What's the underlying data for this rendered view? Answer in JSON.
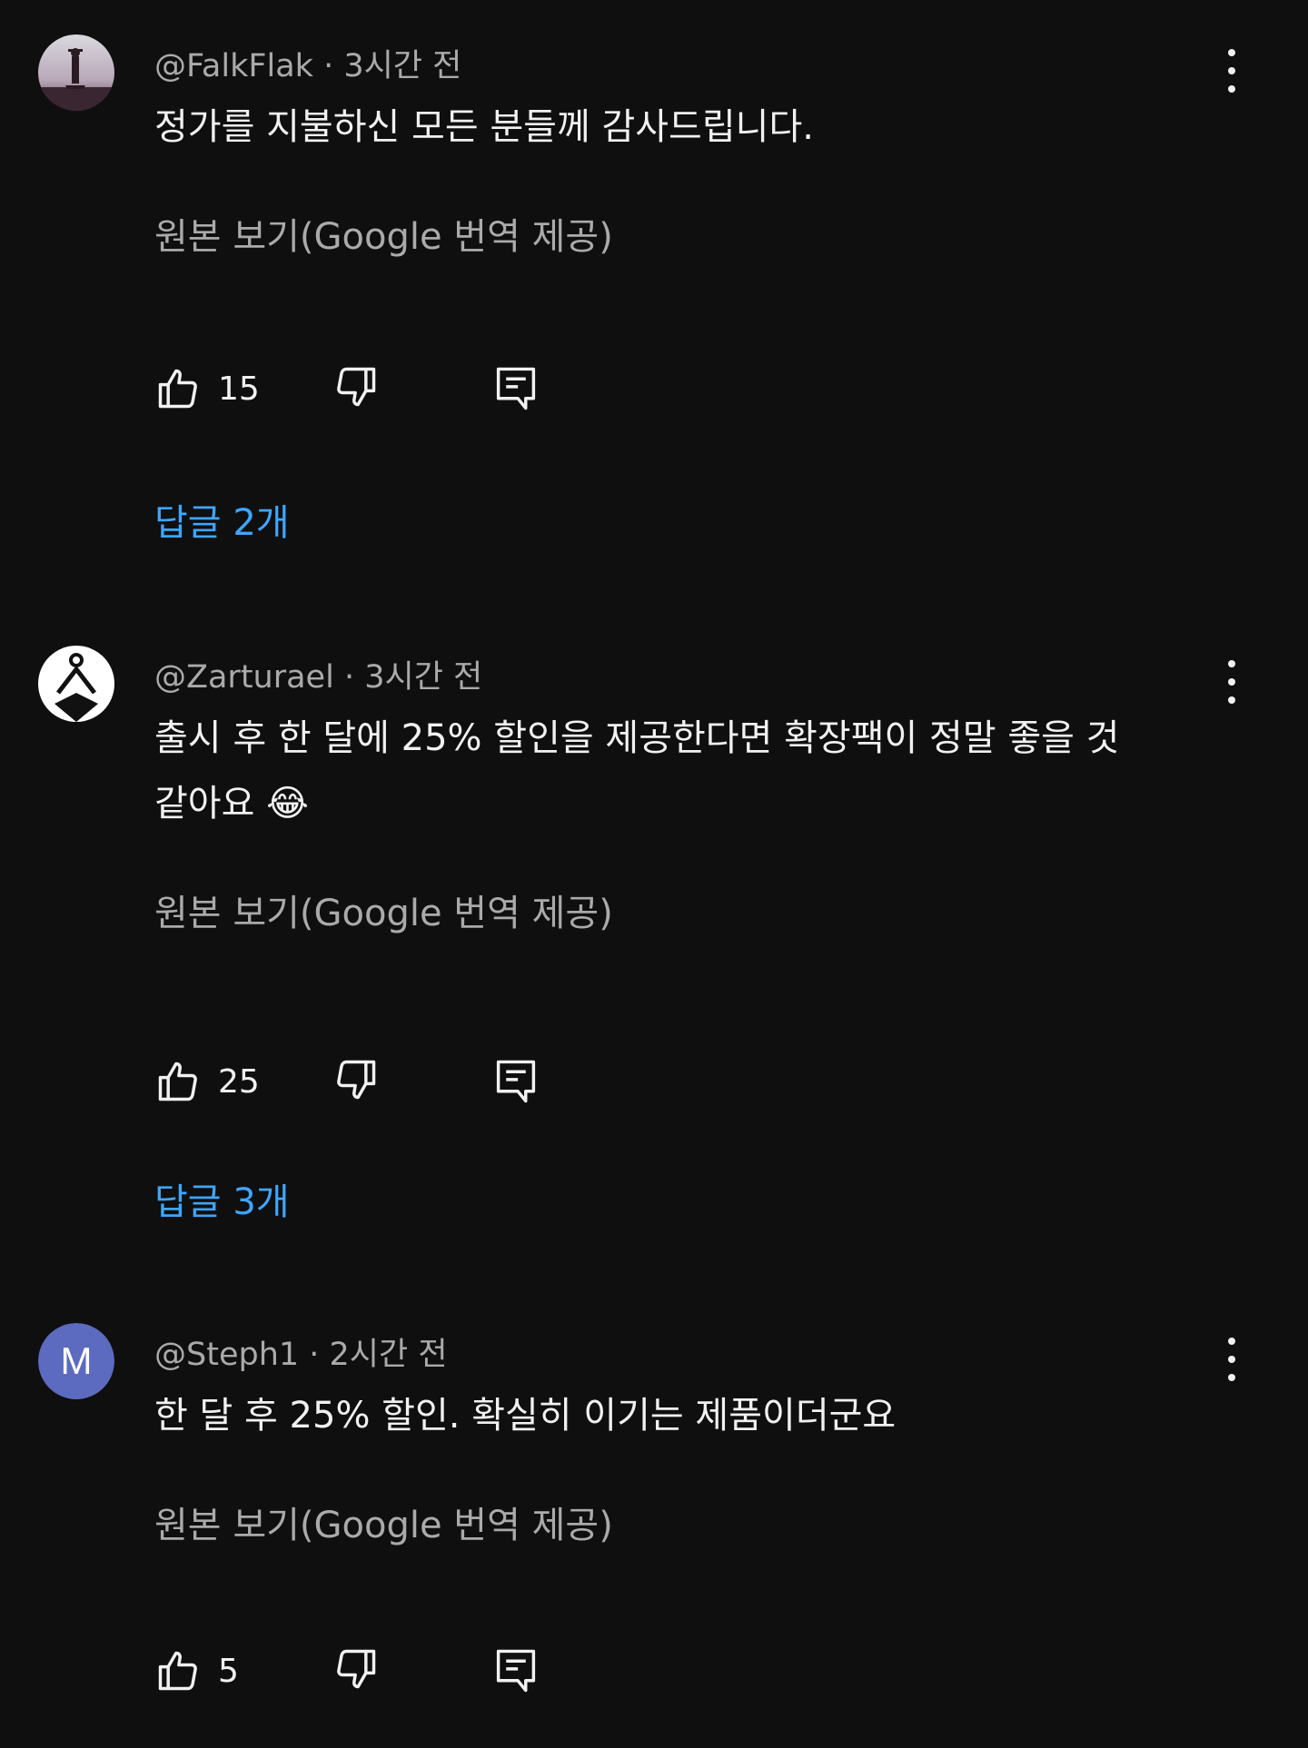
{
  "comments": [
    {
      "handle": "@FalkFlak",
      "time": "· 3시간 전",
      "text": "정가를 지불하신 모든 분들께 감사드립니다.",
      "translate": "원본 보기(Google 번역 제공)",
      "likes": "15",
      "replies": "답글 2개",
      "avatar_icon": "person-silhouette-avatar"
    },
    {
      "handle": "@Zarturael",
      "time": "· 3시간 전",
      "text": "출시 후 한 달에 25% 할인을 제공한다면 확장팩이 정말 좋을 것 같아요 😂",
      "translate": "원본 보기(Google 번역 제공)",
      "likes": "25",
      "replies": "답글 3개",
      "avatar_icon": "figure-logo-avatar"
    },
    {
      "handle": "@Steph1",
      "time": "· 2시간 전",
      "text": "한 달 후 25% 할인. 확실히 이기는 제품이더군요",
      "translate": "원본 보기(Google 번역 제공)",
      "likes": "5",
      "avatar_letter": "M",
      "avatar_color": "#5c6bc0"
    }
  ],
  "colors": {
    "background": "#0f0f0f",
    "link": "#3ea6ff",
    "secondary_text": "#aaaaaa"
  }
}
